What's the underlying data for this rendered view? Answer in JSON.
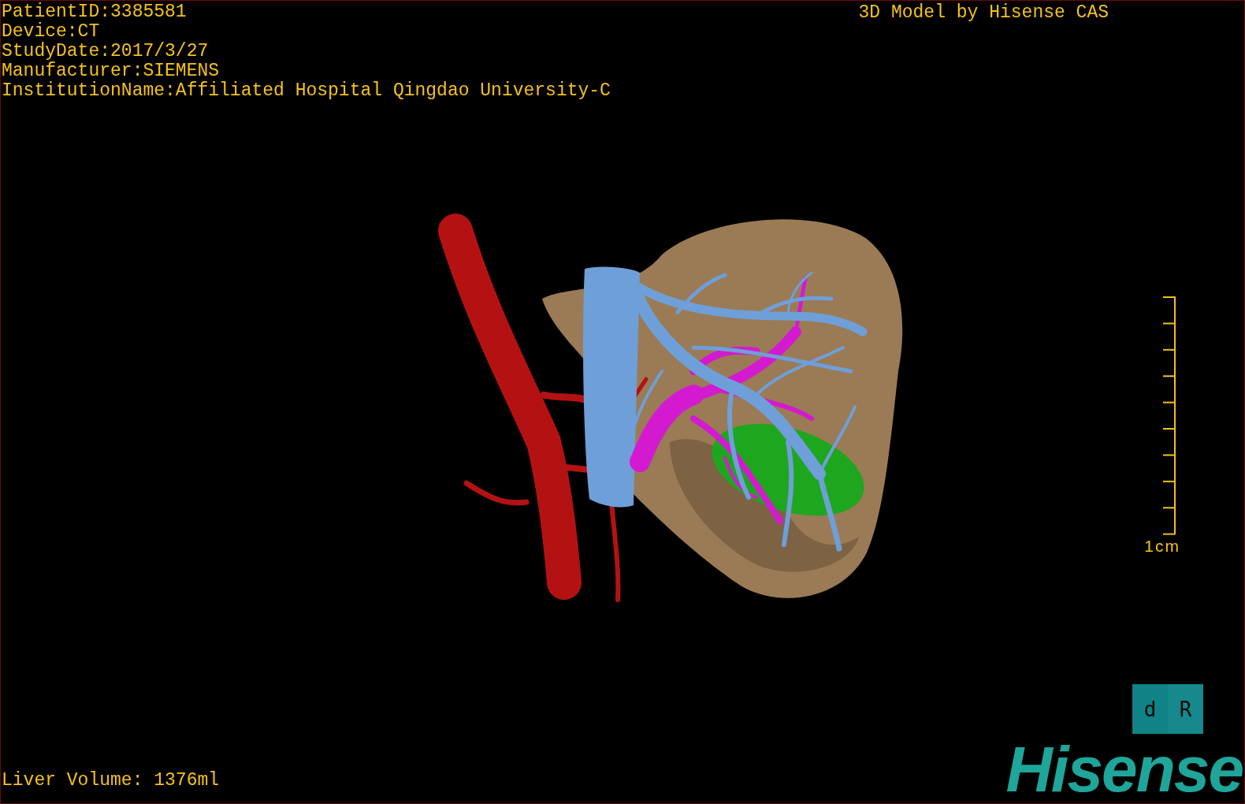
{
  "info_lines": [
    "PatientID:3385581",
    "Device:CT",
    "StudyDate:2017/3/27",
    "Manufacturer:SIEMENS",
    "InstitutionName:Affiliated Hospital Qingdao University-C"
  ],
  "credit": "3D Model by Hisense CAS",
  "scale_bar": {
    "label": "1cm"
  },
  "orientation_cube": {
    "faces": [
      "d",
      "R"
    ]
  },
  "liver_volume": "Liver Volume: 1376ml",
  "logo": "Hisense"
}
